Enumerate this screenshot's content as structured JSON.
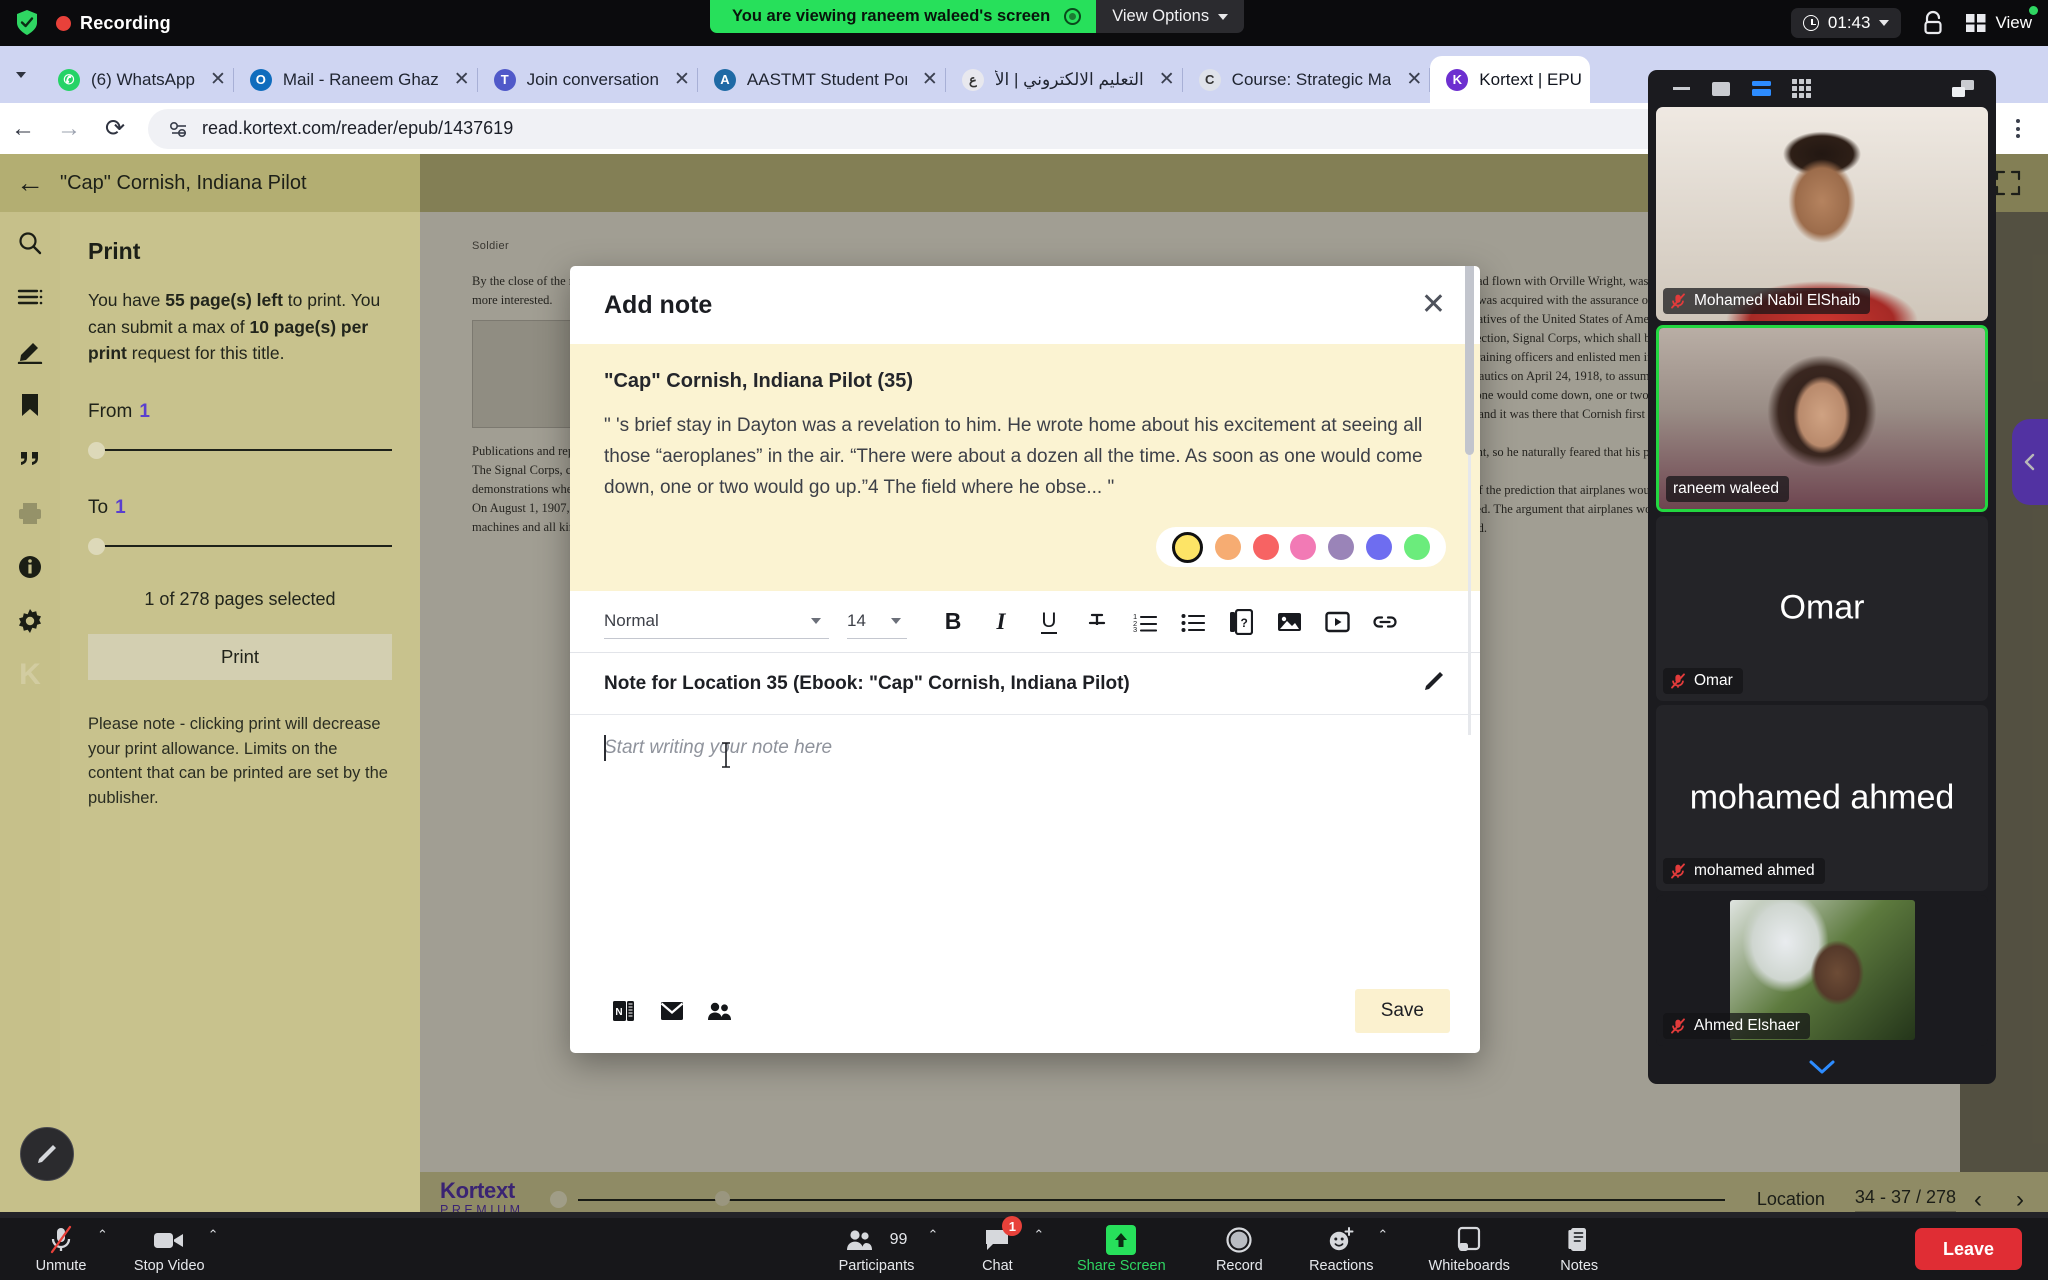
{
  "zoom_top": {
    "recording_label": "Recording",
    "viewing_banner": "You are viewing raneem waleed's screen",
    "view_options": "View Options",
    "clock": "01:43",
    "view_label": "View"
  },
  "browser": {
    "url": "read.kortext.com/reader/epub/1437619",
    "tabs": [
      {
        "title": "(6) WhatsApp",
        "favicon_letter": "",
        "favicon_color": "#25D366",
        "active": false
      },
      {
        "title": "Mail - Raneem Ghaz",
        "favicon_letter": "O",
        "favicon_color": "#0f6cbd",
        "active": false
      },
      {
        "title": "Join conversation",
        "favicon_letter": "T",
        "favicon_color": "#5059c9",
        "active": false
      },
      {
        "title": "AASTMT Student Por",
        "favicon_letter": "A",
        "favicon_color": "#1f6aa5",
        "active": false
      },
      {
        "title": "التعليم الالكتروني | الأ",
        "favicon_letter": "ع",
        "favicon_color": "#e8e8ee",
        "active": false
      },
      {
        "title": "Course: Strategic Ma",
        "favicon_letter": "C",
        "favicon_color": "#dfe2ea",
        "active": false
      },
      {
        "title": "Kortext | EPU",
        "favicon_letter": "K",
        "favicon_color": "#6d2fd0",
        "active": true
      }
    ],
    "close_glyph": "✕"
  },
  "reader": {
    "header_title": "\"Cap\" Cornish, Indiana Pilot",
    "print_panel": {
      "title": "Print",
      "line1_pre": "You have ",
      "line1_bold": "55 page(s) left",
      "line1_post": " to print.",
      "line2_pre": "You can submit a max of ",
      "line2_bold": "10 page(s)",
      "line2_post": "",
      "line3_bold": "per print",
      "line3_post": " request for this title.",
      "from_label": "From",
      "from_value": "1",
      "to_label": "To",
      "to_value": "1",
      "pages_selected": "1 of 278 pages selected",
      "print_button": "Print",
      "footnote": "Please note - clicking print will decrease your print allowance. Limits on the content that can be printed are set by the publisher."
    },
    "footer": {
      "logo_top": "Kortext",
      "logo_bottom": "PREMIUM",
      "location_label": "Location",
      "location_value": "34 - 37 / 278",
      "prev_glyph": "‹",
      "next_glyph": "›"
    },
    "page_text": {
      "header": "Soldier",
      "paragraphs": [
        "By the close of the nineteenth century, the Signal Corps had developed an interest in aerial observation. it. No branch of the Army was more interested.",
        "Publications and reports of the period between 1908 and 1918 described the growing role of the airplane.",
        "The Signal Corps, charged with military communication matters, had a natural interest in aeronautics. The skeptics were many, but the demonstrations when Orville Wright flew at Fort Myer changed many minds.",
        "On August 1, 1907, the Aeronautical Division was formally established and charged with all matters pertaining to military ballooning, air machines and all kindred subjects. After the Wright Flyer completed its trials, the Army ordered one. On August 2, 1909, the Signal Corps accepted it, and Lt. Benjamin Foulois, who had flown with Orville Wright, was assigned to it. Although it was past time for the Army to obtain aircraft of its own, a Curtiss pusher was acquired with the assurance of an instructor alongside.",
        "Be it enacted by the Senate and House of Representatives of the United States of America in Congress assembled, that there be, and which shall be, and is hereby, created an Aviation Section, Signal Corps, which shall be charged with the duty of operating all military aircraft, including balloons and aeroplanes, and of training officers and enlisted men in matters pertaining thereto. An act approved by the Secretary of War and the Director of Military Aeronautics on April 24, 1918, to assume the duties of the section.",
        "\"There were about a dozen all the time. As soon as one would come down, one or two would go up.\" Wilbur and Orville Wright had begun their heavier-than-air experiments in Dayton and it was there that Cornish first feasted his eyes on real airplanes and genuine civilian pilots at the time.",
        "He was not a man who acted on impulse or sentiment, so he naturally feared that his plan might not bring the result he was hoping for: he was going to be a pilot.",
        "Few people in the country at that time were aware of the prediction that airplanes would one day carry passengers; the possibility of knowing them in wartime had barely been considered. The argument that airplanes would never amount to anything was common. When challenged on these troubles, they quickly responded."
      ]
    }
  },
  "modal": {
    "title": "Add note",
    "close_glyph": "✕",
    "quote_title": "\"Cap\" Cornish, Indiana Pilot (35)",
    "quote_body": "\" 's brief stay in Dayton was a revelation to him. He wrote home about his excitement at seeing all those “aeroplanes” in the air. “There were about a dozen all the time. As soon as one would come down, one or two would go up.”4 The field where he obse... \"",
    "colors": [
      {
        "name": "yellow",
        "hex": "#fde466",
        "selected": true
      },
      {
        "name": "orange",
        "hex": "#f6ac72",
        "selected": false
      },
      {
        "name": "red",
        "hex": "#f76363",
        "selected": false
      },
      {
        "name": "pink",
        "hex": "#f27ab5",
        "selected": false
      },
      {
        "name": "purple",
        "hex": "#9a84b8",
        "selected": false
      },
      {
        "name": "blue",
        "hex": "#6e6df0",
        "selected": false
      },
      {
        "name": "green",
        "hex": "#6bec7c",
        "selected": false
      }
    ],
    "toolbar": {
      "style_value": "Normal",
      "size_value": "14",
      "bold": "B",
      "italic": "I",
      "underline": "U",
      "strikethrough": "S",
      "ordered_list": "ol",
      "bullet_list": "ul",
      "flashcard": "?",
      "image": "img",
      "video": "video",
      "link": "link"
    },
    "note_title": "Note for Location 35 (Ebook: \"Cap\" Cornish, Indiana Pilot)",
    "note_placeholder": "Start writing your note here",
    "footer_icons": [
      "onenote-icon",
      "email-icon",
      "share-people-icon"
    ],
    "save_label": "Save"
  },
  "video_panel": {
    "participants": [
      {
        "name": "Mohamed Nabil ElShaib",
        "type": "video",
        "muted": true,
        "speaking": false,
        "photo": "ph-nabil"
      },
      {
        "name": "raneem waleed",
        "type": "video",
        "muted": false,
        "speaking": true,
        "photo": "ph-raneem"
      },
      {
        "name": "Omar",
        "type": "name",
        "muted": true,
        "speaking": false,
        "display": "Omar"
      },
      {
        "name": "mohamed ahmed",
        "type": "name",
        "muted": true,
        "speaking": false,
        "display": "mohamed ahmed"
      },
      {
        "name": "Ahmed Elshaer",
        "type": "photo",
        "muted": true,
        "speaking": false,
        "photo": "ph-ahmed"
      }
    ]
  },
  "zoom_bottom": {
    "buttons": [
      {
        "label": "Unmute",
        "name": "unmute-button",
        "caret": true,
        "badge": null
      },
      {
        "label": "Stop Video",
        "name": "stop-video-button",
        "caret": true,
        "badge": null
      },
      {
        "label": "Participants",
        "name": "participants-button",
        "caret": true,
        "badge": null,
        "count": "99"
      },
      {
        "label": "Chat",
        "name": "chat-button",
        "caret": true,
        "badge": "1"
      },
      {
        "label": "Share Screen",
        "name": "share-screen-button",
        "caret": false,
        "badge": null,
        "green": true
      },
      {
        "label": "Record",
        "name": "record-button",
        "caret": false,
        "badge": null
      },
      {
        "label": "Reactions",
        "name": "reactions-button",
        "caret": true,
        "badge": null
      },
      {
        "label": "Whiteboards",
        "name": "whiteboards-button",
        "caret": false,
        "badge": null
      },
      {
        "label": "Notes",
        "name": "notes-button",
        "caret": false,
        "badge": null
      }
    ],
    "leave_label": "Leave"
  }
}
